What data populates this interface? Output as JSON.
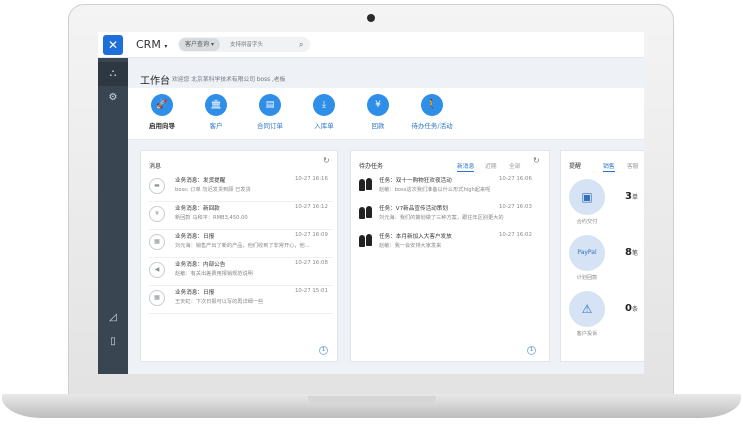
{
  "app": {
    "name": "CRM"
  },
  "search": {
    "type_label": "客户查询",
    "placeholder": "支持拼音字头"
  },
  "sidebar": {
    "items": [
      {
        "icon": "sitemap-icon"
      },
      {
        "icon": "gears-icon"
      },
      {
        "icon": "area-chart-icon"
      },
      {
        "icon": "tablet-icon"
      }
    ]
  },
  "workspace": {
    "title": "工作台",
    "subtitle": "欢迎您 北京某科学技术有限公司 boss ,老板"
  },
  "shortcuts": [
    {
      "label": "启用向导",
      "icon": "rocket-icon"
    },
    {
      "label": "客户",
      "icon": "bank-icon"
    },
    {
      "label": "合同订单",
      "icon": "document-icon"
    },
    {
      "label": "入库单",
      "icon": "download-icon"
    },
    {
      "label": "回款",
      "icon": "yen-icon"
    },
    {
      "label": "待办任务/活动",
      "icon": "walk-icon"
    }
  ],
  "messages": {
    "title": "消息",
    "items": [
      {
        "title": "业务消息：发货提醒",
        "time": "10-27 16:16",
        "body": "boss: 订单 勿迟发货到顾 已发货",
        "icon": "truck-icon"
      },
      {
        "title": "业务消息：新回款",
        "time": "10-27 16:12",
        "body": "新回款 马和平：RMB3,450.00",
        "icon": "yen-icon"
      },
      {
        "title": "业务消息：日报",
        "time": "10-27 16:09",
        "body": "刘元海：销售产出了新的产品，他们收到了非常开心，他...",
        "icon": "calendar-icon"
      },
      {
        "title": "业务消息：内部公告",
        "time": "10-27 16:08",
        "body": "赵敏：有关出差费用报销规范说明",
        "icon": "bullhorn-icon"
      },
      {
        "title": "业务消息：日报",
        "time": "10-27 15:01",
        "body": "王天虹：下次日报可以写的再详细一些",
        "icon": "calendar-icon"
      }
    ],
    "page": "1"
  },
  "todos": {
    "title": "待办任务",
    "tabs": [
      "新消息",
      "近期",
      "全部"
    ],
    "items": [
      {
        "title": "任务：双十一购物狂欢夜活动",
        "time": "10-27 16:06",
        "body": "赵敏：boss这次我们准备以什么形式high起来呢"
      },
      {
        "title": "任务：V7新品宣传活动策划",
        "time": "10-27 16:03",
        "body": "刘元海：我们的策划做了三种方案，跟往年区别更大的"
      },
      {
        "title": "任务：本月新加入大客户发放",
        "time": "10-27 16:02",
        "body": "赵敏：我一会安排大家发来"
      }
    ],
    "page": "1"
  },
  "reminders": {
    "title": "提醒",
    "tabs": [
      "销售",
      "客服"
    ],
    "stats": [
      {
        "label": "合约交付",
        "value": "3",
        "unit": "单",
        "icon": "cubes-icon"
      },
      {
        "label": "计划回款",
        "value": "8",
        "unit": "笔",
        "icon": "paypal-icon"
      },
      {
        "label": "客户投诉",
        "value": "0",
        "unit": "条",
        "icon": "warning-icon"
      }
    ]
  }
}
